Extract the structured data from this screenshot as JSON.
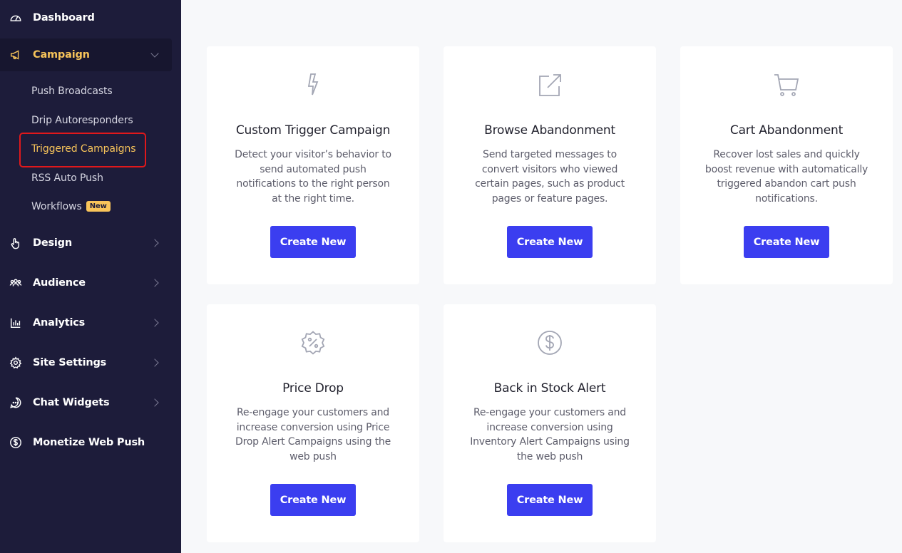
{
  "sidebar": {
    "items": [
      {
        "label": "Dashboard",
        "icon": "dashboard-icon"
      },
      {
        "label": "Campaign",
        "icon": "megaphone-icon"
      },
      {
        "label": "Design",
        "icon": "hand-pointer-icon"
      },
      {
        "label": "Audience",
        "icon": "users-icon"
      },
      {
        "label": "Analytics",
        "icon": "bar-chart-icon"
      },
      {
        "label": "Site Settings",
        "icon": "gear-icon"
      },
      {
        "label": "Chat Widgets",
        "icon": "chat-icon"
      },
      {
        "label": "Monetize Web Push",
        "icon": "dollar-icon"
      }
    ],
    "campaign_subitems": [
      {
        "label": "Push Broadcasts"
      },
      {
        "label": "Drip Autoresponders"
      },
      {
        "label": "Triggered Campaigns"
      },
      {
        "label": "RSS Auto Push"
      },
      {
        "label": "Workflows",
        "badge": "New"
      }
    ]
  },
  "cards": [
    {
      "icon": "lightning-icon",
      "title": "Custom Trigger Campaign",
      "description": "Detect your visitor’s behavior to send automated push notifications to the right person at the right time.",
      "button": "Create New"
    },
    {
      "icon": "external-link-icon",
      "title": "Browse Abandonment",
      "description": "Send targeted messages to convert visitors who viewed certain pages, such as product pages or feature pages.",
      "button": "Create New"
    },
    {
      "icon": "cart-icon",
      "title": "Cart Abandonment",
      "description": "Recover lost sales and quickly boost revenue with automatically triggered abandon cart push notifications.",
      "button": "Create New"
    },
    {
      "icon": "percent-badge-icon",
      "title": "Price Drop",
      "description": "Re-engage your customers and increase conversion using Price Drop Alert Campaigns using the web push",
      "button": "Create New"
    },
    {
      "icon": "dollar-circle-icon",
      "title": "Back in Stock Alert",
      "description": "Re-engage your customers and increase conversion using Inventory Alert Campaigns using the web push",
      "button": "Create New"
    }
  ],
  "colors": {
    "sidebar_bg": "#1d1c3a",
    "active_accent": "#f6c35a",
    "button_bg": "#3b3ef0",
    "highlight_border": "#e0181b",
    "page_bg": "#f7f8fa"
  }
}
